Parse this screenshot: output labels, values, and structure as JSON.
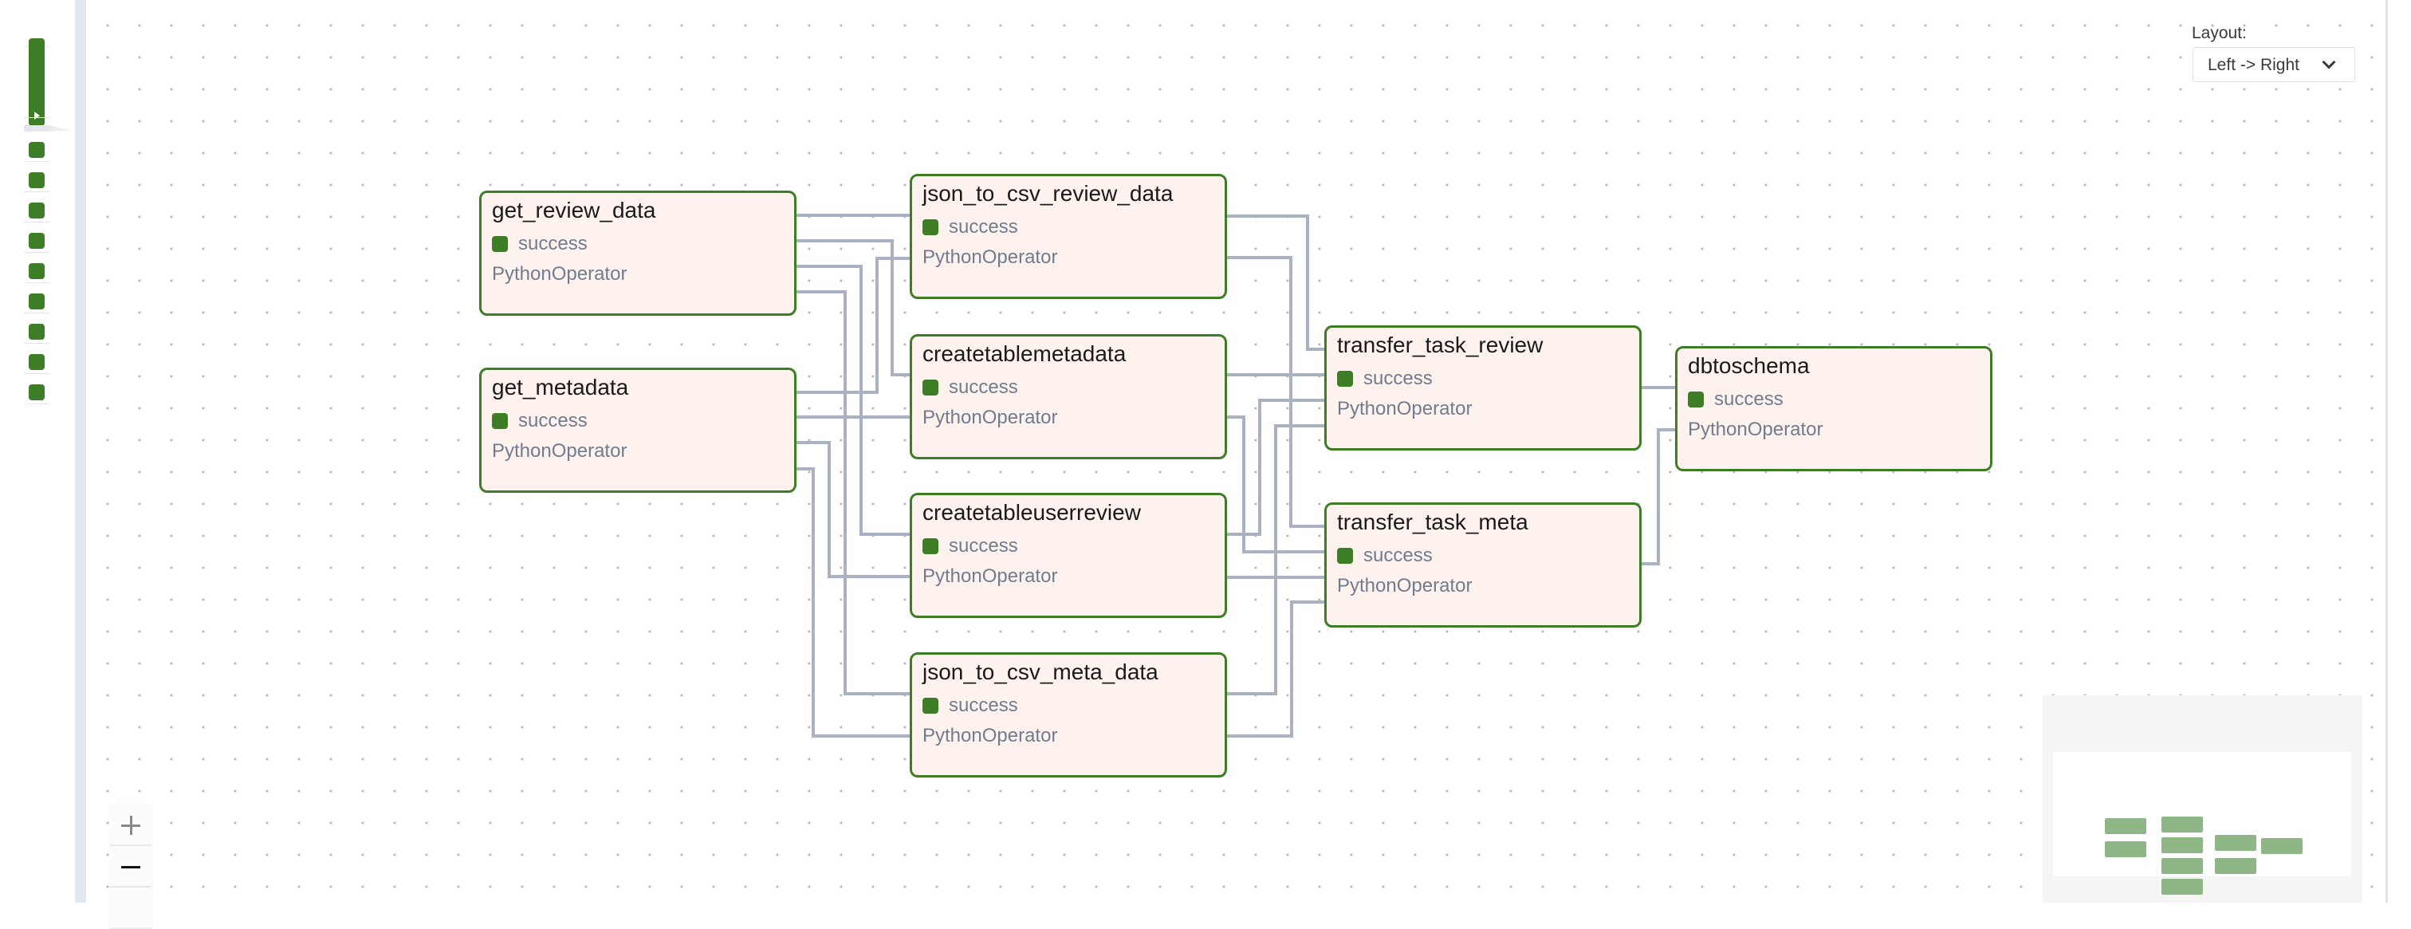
{
  "grid_panel": {
    "run": {
      "state": "success",
      "color": "#3d7d26",
      "icon": "play-icon"
    },
    "task_states": [
      "success",
      "success",
      "success",
      "success",
      "success",
      "success",
      "success",
      "success",
      "success"
    ]
  },
  "layout": {
    "label": "Layout:",
    "selected": "Left -> Right"
  },
  "zoom_controls": {
    "zoom_in_icon": "plus-icon",
    "zoom_out_icon": "minus-icon"
  },
  "colors": {
    "success": "#3d7d26",
    "node_bg": "#fdf2ee",
    "edge": "#a8b2c1"
  },
  "nodes": [
    {
      "id": "get_review_data",
      "label": "get_review_data",
      "state": "success",
      "operator": "PythonOperator"
    },
    {
      "id": "get_metadata",
      "label": "get_metadata",
      "state": "success",
      "operator": "PythonOperator"
    },
    {
      "id": "json_to_csv_review_data",
      "label": "json_to_csv_review_data",
      "state": "success",
      "operator": "PythonOperator"
    },
    {
      "id": "createtablemetadata",
      "label": "createtablemetadata",
      "state": "success",
      "operator": "PythonOperator"
    },
    {
      "id": "createtableuserreview",
      "label": "createtableuserreview",
      "state": "success",
      "operator": "PythonOperator"
    },
    {
      "id": "json_to_csv_meta_data",
      "label": "json_to_csv_meta_data",
      "state": "success",
      "operator": "PythonOperator"
    },
    {
      "id": "transfer_task_review",
      "label": "transfer_task_review",
      "state": "success",
      "operator": "PythonOperator"
    },
    {
      "id": "transfer_task_meta",
      "label": "transfer_task_meta",
      "state": "success",
      "operator": "PythonOperator"
    },
    {
      "id": "dbtoschema",
      "label": "dbtoschema",
      "state": "success",
      "operator": "PythonOperator"
    }
  ],
  "edges": [
    {
      "source": "get_review_data",
      "target": "json_to_csv_review_data"
    },
    {
      "source": "get_review_data",
      "target": "createtablemetadata"
    },
    {
      "source": "get_review_data",
      "target": "createtableuserreview"
    },
    {
      "source": "get_review_data",
      "target": "json_to_csv_meta_data"
    },
    {
      "source": "get_metadata",
      "target": "json_to_csv_review_data"
    },
    {
      "source": "get_metadata",
      "target": "createtablemetadata"
    },
    {
      "source": "get_metadata",
      "target": "createtableuserreview"
    },
    {
      "source": "get_metadata",
      "target": "json_to_csv_meta_data"
    },
    {
      "source": "json_to_csv_review_data",
      "target": "transfer_task_review"
    },
    {
      "source": "json_to_csv_review_data",
      "target": "transfer_task_meta"
    },
    {
      "source": "createtablemetadata",
      "target": "transfer_task_review"
    },
    {
      "source": "createtablemetadata",
      "target": "transfer_task_meta"
    },
    {
      "source": "createtableuserreview",
      "target": "transfer_task_review"
    },
    {
      "source": "createtableuserreview",
      "target": "transfer_task_meta"
    },
    {
      "source": "json_to_csv_meta_data",
      "target": "transfer_task_review"
    },
    {
      "source": "json_to_csv_meta_data",
      "target": "transfer_task_meta"
    },
    {
      "source": "transfer_task_review",
      "target": "dbtoschema"
    },
    {
      "source": "transfer_task_meta",
      "target": "dbtoschema"
    }
  ]
}
